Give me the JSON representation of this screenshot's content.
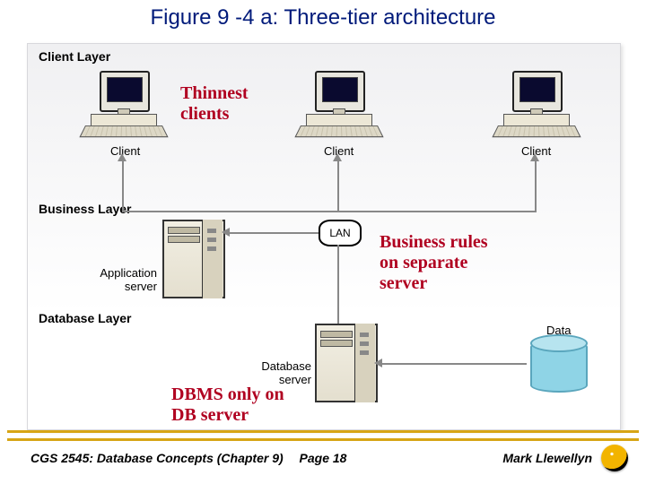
{
  "title": "Figure 9 -4 a: Three-tier architecture",
  "layers": {
    "client": "Client Layer",
    "business": "Business Layer",
    "database": "Database Layer"
  },
  "labels": {
    "client_node": "Client",
    "lan": "LAN",
    "app_server": "Application\nserver",
    "db_server": "Database\nserver",
    "data": "Data"
  },
  "annotations": {
    "thinnest": "Thinnest\nclients",
    "business_rules": "Business rules\non separate\nserver",
    "dbms_only": "DBMS only on\nDB server"
  },
  "footer": {
    "left": "CGS 2545: Database Concepts  (Chapter 9)",
    "center": "Page 18",
    "right": "Mark Llewellyn"
  }
}
